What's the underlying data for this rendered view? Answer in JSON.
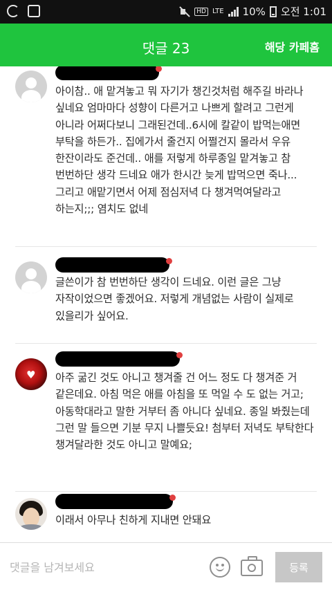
{
  "statusbar": {
    "left_icons": [
      "gallery-icon",
      "checkbox-icon"
    ],
    "hd": "HD",
    "lte": "LTE",
    "battery": "10%",
    "time": "오전 1:01"
  },
  "header": {
    "title": "댓글 23",
    "link_label": "해당 카페홈"
  },
  "comments": [
    {
      "author_hidden": true,
      "avatar": "default-avatar",
      "text": "아이참.. 애 맡겨놓고 뭐 자기가 챙긴것처럼 해주길 바라나 싶네요 엄마마다 성향이 다른거고 나쁘게 할려고 그런게 아니라 어쩌다보니 그래된건데..6시에 칼같이 밥먹는애면 부탁을 하든가.. 집에가서 줄건지 어쩔건지 몰라서 우유 한잔이라도 준건데.. 애를 저렇게 하루종일 맡겨놓고 참 번번하단 생각 드네요 애가 한시간 늦게 밥먹으면 죽나...그리고 애맡기면서 어제 점심저녁 다 챙겨먹여달라고 하는지;;; 염치도 없네"
    },
    {
      "author_hidden": true,
      "avatar": "default-avatar",
      "text": "글쓴이가 참 번번하단 생각이 드네요. 이런 글은 그냥 자작이었으면 좋겠어요. 저렇게 개념없는 사람이 실제로 있을리가 싶어요."
    },
    {
      "author_hidden": true,
      "avatar": "heart-avatar",
      "text": "아주 굶긴 것도 아니고 챙겨줄 건 어느 정도 다 챙겨준 거 같은데요. 아침 먹은 애를 아침을 또 먹일 수 도 없는 거고; 아동학대라고 말한 거부터 좀 아니다 싶네요. 종일 봐줬는데 그런 말 들으면 기분 무지 나쁠듯요! 첨부터 저녁도 부탁한다 챙겨달라한 것도 아니고 말예요;"
    },
    {
      "author_hidden": true,
      "avatar": "photo-avatar",
      "text": "이래서 아무나 친하게 지내면 안돼요"
    }
  ],
  "input": {
    "placeholder": "댓글을 남겨보세요",
    "submit_label": "등록"
  },
  "colors": {
    "header_green": "#1fc43e",
    "submit_gray": "#c7c7c7"
  }
}
